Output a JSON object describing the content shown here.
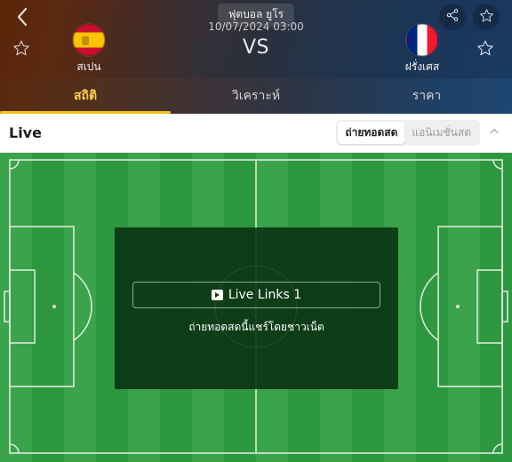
{
  "header": {
    "back_icon": "chevron-left-icon",
    "favorite_icon": "star-outline-icon",
    "share_icon": "share-icon",
    "league_badge": "ฟุตบอล ยูโร",
    "match_time": "10/07/2024 03:00",
    "vs": "VS",
    "home_team": {
      "name": "สเปน",
      "flag": "spain-flag"
    },
    "away_team": {
      "name": "ฝรั่งเศส",
      "flag": "france-flag"
    },
    "gradient_left": "#5a2509",
    "gradient_right": "#1a3a60"
  },
  "tabs": [
    {
      "label": "สถิติ",
      "active": true
    },
    {
      "label": "วิเคราะห์",
      "active": false
    },
    {
      "label": "ราคา",
      "active": false
    }
  ],
  "tab_accent": "#f5c21b",
  "live_bar": {
    "title": "Live",
    "segments": [
      {
        "label": "ถ่ายทอดสด",
        "active": true
      },
      {
        "label": "แอนิเมชั่นสด",
        "active": false
      }
    ],
    "collapse_icon": "chevron-up-icon"
  },
  "pitch": {
    "color": "#2f9e41",
    "line_color": "#e8f2e8"
  },
  "overlay": {
    "button_label": "Live Links 1",
    "button_icon": "tv-play-icon",
    "note": "ถ่ายทอดสดนี้แชร์โดยชาวเน็ต",
    "background": "#083011"
  }
}
